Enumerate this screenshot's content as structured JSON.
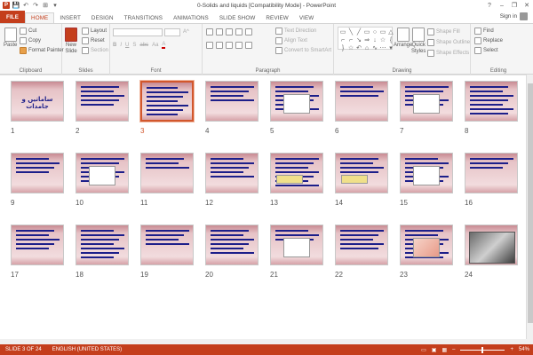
{
  "window": {
    "title": "0-Solids and liquids [Compatibility Mode] - PowerPoint",
    "minimize": "–",
    "restore": "❐",
    "close": "✕",
    "help": "?"
  },
  "qat": {
    "app": "P",
    "save": "💾",
    "undo": "↶",
    "redo": "↷",
    "start": "⊞",
    "more": "▾"
  },
  "tabs": [
    "FILE",
    "HOME",
    "INSERT",
    "DESIGN",
    "TRANSITIONS",
    "ANIMATIONS",
    "SLIDE SHOW",
    "REVIEW",
    "VIEW"
  ],
  "active_tab": "HOME",
  "signin": "Sign in",
  "ribbon": {
    "clipboard": {
      "label": "Clipboard",
      "paste": "Paste",
      "cut": "Cut",
      "copy": "Copy",
      "format_painter": "Format Painter"
    },
    "slides": {
      "label": "Slides",
      "new_slide": "New",
      "new_slide2": "Slide",
      "layout": "Layout",
      "reset": "Reset",
      "section": "Section"
    },
    "font": {
      "label": "Font",
      "bold": "B",
      "italic": "I",
      "underline": "U",
      "strike": "S",
      "shadow": "abc",
      "case": "Aa",
      "clear": "A"
    },
    "paragraph": {
      "label": "Paragraph",
      "text_direction": "Text Direction",
      "align_text": "Align Text",
      "convert": "Convert to SmartArt"
    },
    "drawing": {
      "label": "Drawing",
      "arrange": "Arrange",
      "quick_styles": "Quick",
      "quick_styles2": "Styles",
      "shape_fill": "Shape Fill",
      "shape_outline": "Shape Outline",
      "shape_effects": "Shape Effects"
    },
    "shapes_glyphs": [
      "▭",
      "╲",
      "╱",
      "▭",
      "○",
      "▭",
      "△",
      "⌐",
      "⌐",
      "↘",
      "⇒",
      "↓",
      "☆",
      "{",
      "}",
      "☆",
      "↶",
      "⌂",
      "∿",
      "⋯",
      "▾"
    ],
    "editing": {
      "label": "Editing",
      "find": "Find",
      "replace": "Replace",
      "select": "Select"
    }
  },
  "slides": [
    {
      "num": "1",
      "title": "ساماتیں و جامدات"
    },
    {
      "num": "2"
    },
    {
      "num": "3",
      "selected": true
    },
    {
      "num": "4"
    },
    {
      "num": "5"
    },
    {
      "num": "6"
    },
    {
      "num": "7"
    },
    {
      "num": "8"
    },
    {
      "num": "9"
    },
    {
      "num": "10"
    },
    {
      "num": "11"
    },
    {
      "num": "12"
    },
    {
      "num": "13"
    },
    {
      "num": "14"
    },
    {
      "num": "15"
    },
    {
      "num": "16"
    },
    {
      "num": "17"
    },
    {
      "num": "18"
    },
    {
      "num": "19"
    },
    {
      "num": "20"
    },
    {
      "num": "21"
    },
    {
      "num": "22"
    },
    {
      "num": "23"
    },
    {
      "num": "24"
    }
  ],
  "status": {
    "slide": "SLIDE 3 OF 24",
    "language": "ENGLISH (UNITED STATES)",
    "zoom": "54%",
    "zoom_minus": "–",
    "zoom_plus": "+"
  },
  "colors": {
    "accent": "#c43e1c",
    "selected_border": "#d2572d",
    "slide_text": "#1d1f8a"
  }
}
